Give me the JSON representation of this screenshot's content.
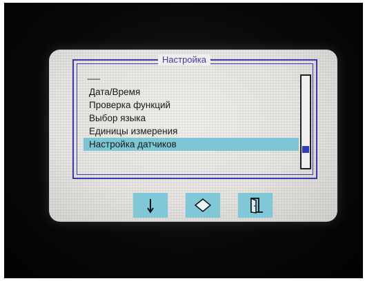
{
  "screen": {
    "title": "Настройка",
    "menu": [
      {
        "label": "-------",
        "selected": false,
        "separator": true
      },
      {
        "label": "Дата/Время",
        "selected": false
      },
      {
        "label": "Проверка функций",
        "selected": false
      },
      {
        "label": "Выбор языка",
        "selected": false
      },
      {
        "label": "Единицы измерения",
        "selected": false
      },
      {
        "label": "Настройка датчиков",
        "selected": true
      }
    ],
    "scroll_position": 0.82,
    "toolbar": [
      {
        "icon": "arrow-down-icon"
      },
      {
        "icon": "diamond-enter-icon"
      },
      {
        "icon": "exit-door-icon"
      }
    ]
  },
  "colors": {
    "frame": "#3a3aa8",
    "selection": "#7cc6d6",
    "button": "#80c8d8",
    "scroll_thumb": "#2d3fb2"
  }
}
